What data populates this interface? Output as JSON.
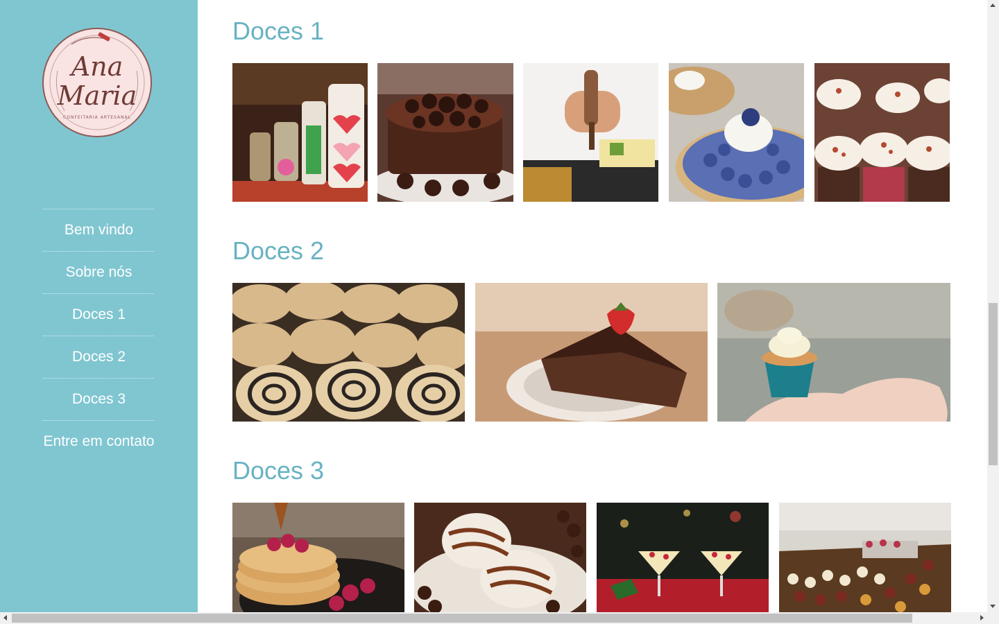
{
  "logo": {
    "line1": "Ana",
    "line2": "Maria",
    "tagline": "CONFEITARIA ARTESANAL"
  },
  "nav": {
    "items": [
      {
        "label": "Bem vindo"
      },
      {
        "label": "Sobre nós"
      },
      {
        "label": "Doces 1"
      },
      {
        "label": "Doces 2"
      },
      {
        "label": "Doces 3"
      },
      {
        "label": "Entre em contato"
      }
    ]
  },
  "sections": [
    {
      "title": "Doces 1"
    },
    {
      "title": "Doces 2"
    },
    {
      "title": "Doces 3"
    }
  ],
  "colors": {
    "sidebar": "#80c6d1",
    "heading": "#68b2c2",
    "nav_text": "#ffffff"
  }
}
